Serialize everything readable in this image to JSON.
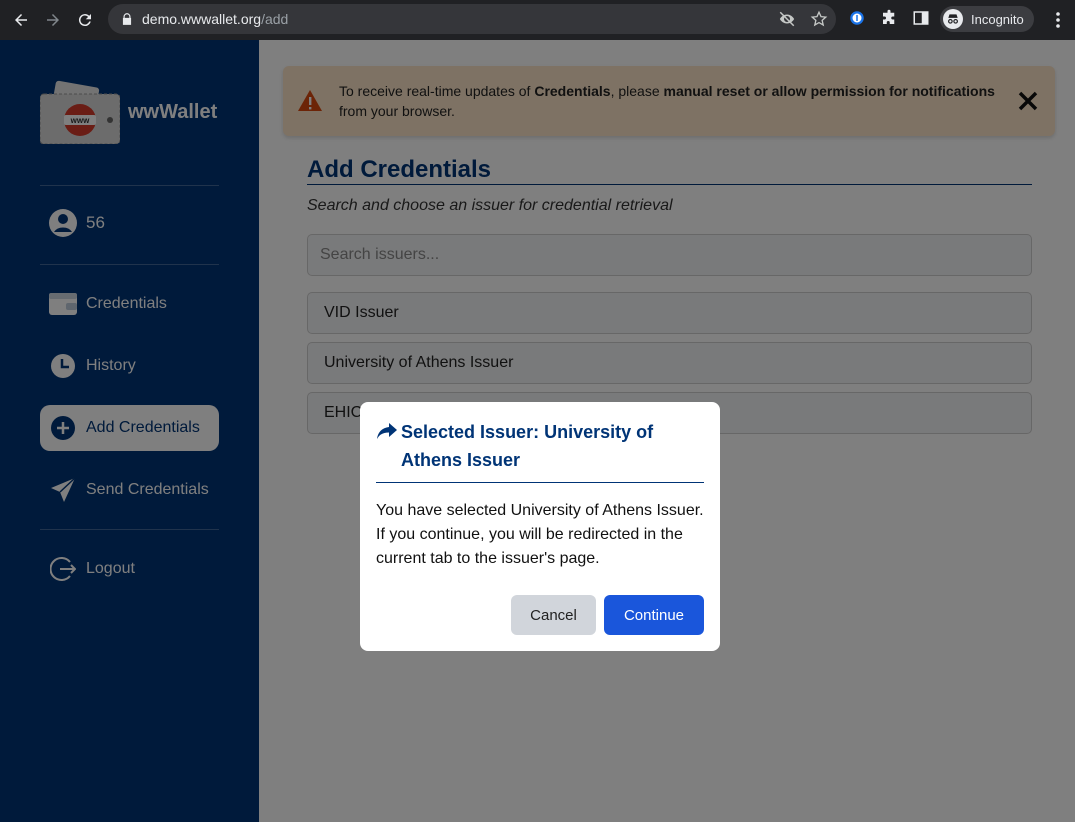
{
  "browser": {
    "url_host": "demo.wwwallet.org",
    "url_path": "/add",
    "profile_label": "Incognito"
  },
  "sidebar": {
    "brand_name": "wwWallet",
    "logo_text": "www",
    "user_name": "56",
    "items": [
      {
        "label": "Credentials",
        "icon": "wallet-icon"
      },
      {
        "label": "History",
        "icon": "clock-icon"
      },
      {
        "label": "Add Credentials",
        "icon": "plus-circle-icon"
      },
      {
        "label": "Send Credentials",
        "icon": "send-icon"
      },
      {
        "label": "Logout",
        "icon": "logout-icon"
      }
    ]
  },
  "alert": {
    "text_before": "To receive real-time updates of ",
    "bold_1": "Credentials",
    "text_middle": ", please ",
    "bold_2": "manual reset or allow permission for notifications",
    "text_after": " from your browser."
  },
  "main": {
    "title": "Add Credentials",
    "subtitle": "Search and choose an issuer for credential retrieval",
    "search_placeholder": "Search issuers...",
    "issuers": [
      "VID Issuer",
      "University of Athens Issuer",
      "EHIC Issuer"
    ]
  },
  "modal": {
    "title": "Selected Issuer: University of Athens Issuer",
    "body": "You have selected University of Athens Issuer. If you continue, you will be redirected in the current tab to the issuer's page.",
    "cancel_label": "Cancel",
    "continue_label": "Continue"
  },
  "colors": {
    "brand": "#003476",
    "primary_button": "#1a56db",
    "alert_bg": "#fde5c8",
    "alert_icon": "#d9480f"
  }
}
